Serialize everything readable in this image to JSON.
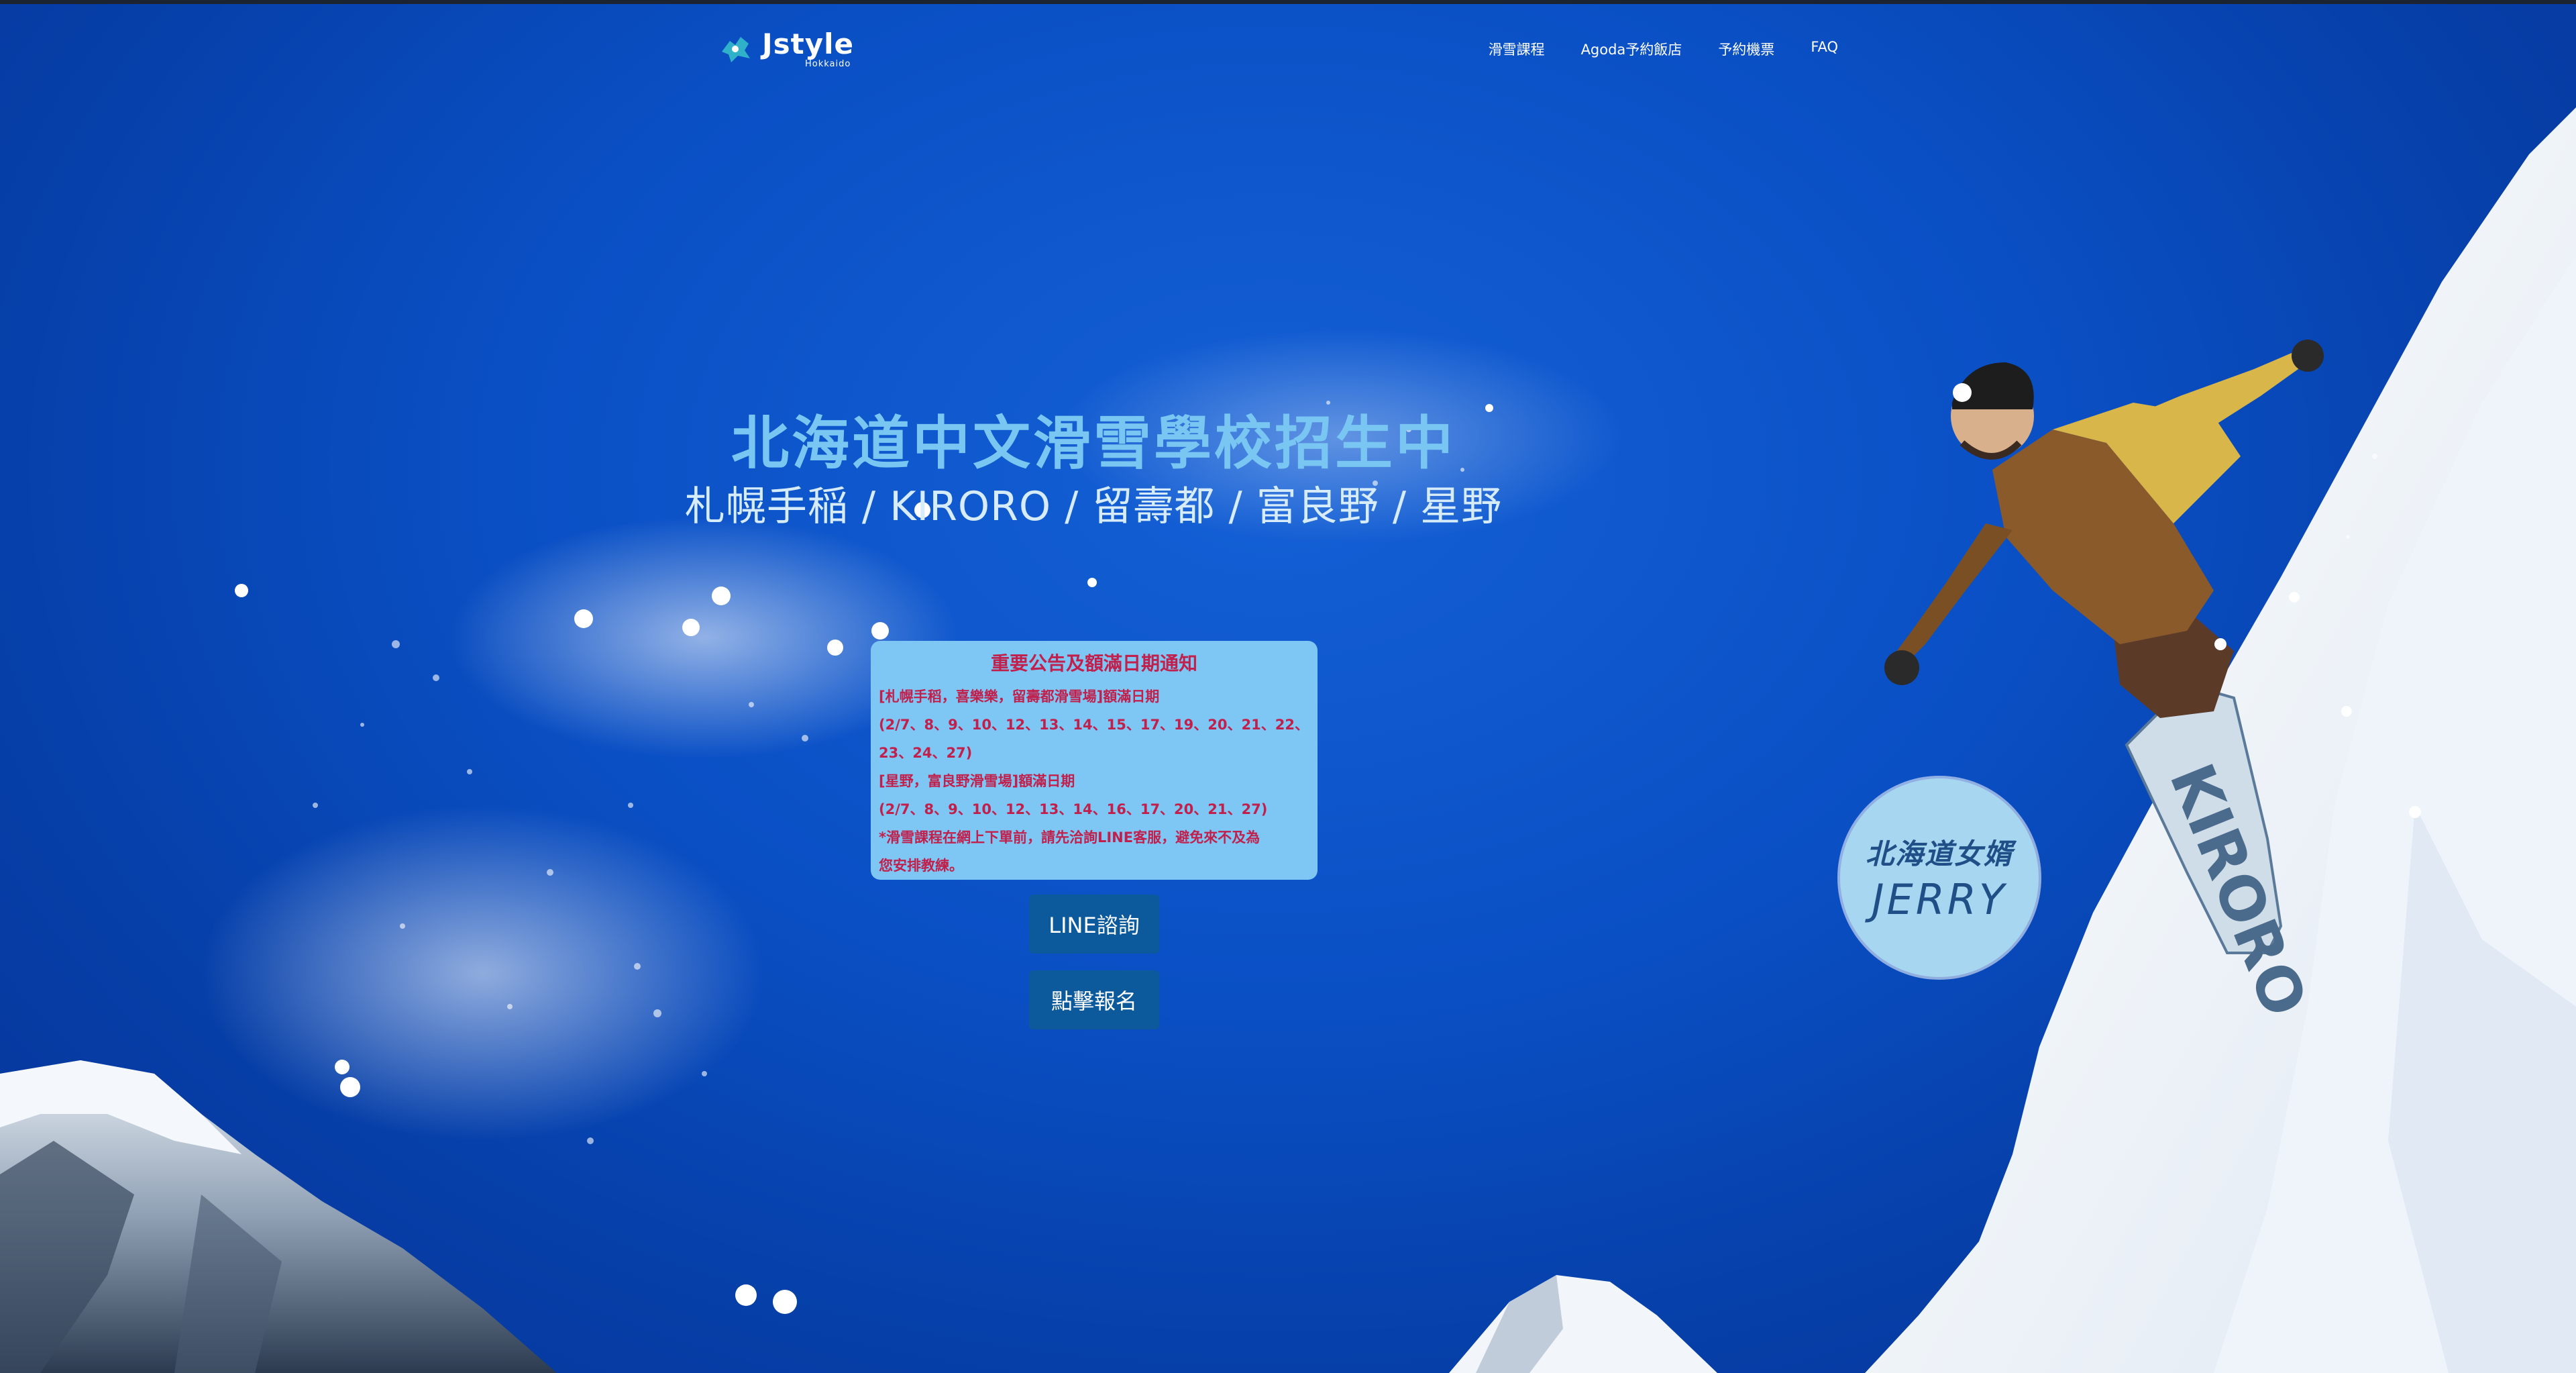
{
  "brand": {
    "name": "Jstyle",
    "sub": "Hokkaido"
  },
  "nav": {
    "items": [
      {
        "label": "滑雪課程"
      },
      {
        "label": "Agoda予約飯店"
      },
      {
        "label": "予約機票"
      },
      {
        "label": "FAQ"
      }
    ]
  },
  "hero": {
    "title": "北海道中文滑雪學校招生中",
    "subtitle": "札幌手稲 / KIRORO / 留壽都 / 富良野 / 星野"
  },
  "notice": {
    "title": "重要公告及額滿日期通知",
    "lines": [
      "[札幌手稻，喜樂樂，留壽都滑雪場]額滿日期",
      "(2/7、8、9、10、12、13、14、15、17、19、20、21、22、",
      "23、24、27)",
      "[星野，富良野滑雪場]額滿日期",
      "(2/7、8、9、10、12、13、14、16、17、20、21、27)",
      "*滑雪課程在網上下單前，請先洽詢LINE客服，避免來不及為",
      "您安排教練。"
    ]
  },
  "buttons": {
    "line": "LINE諮詢",
    "signup": "點擊報名"
  },
  "badge": {
    "top": "北海道女婿",
    "name": "JERRY"
  },
  "colors": {
    "sky": "#0a4fc4",
    "title": "#79c6f2",
    "notice_bg": "#7ec6f3",
    "notice_text": "#c2204c",
    "button": "#0c5a9c"
  }
}
